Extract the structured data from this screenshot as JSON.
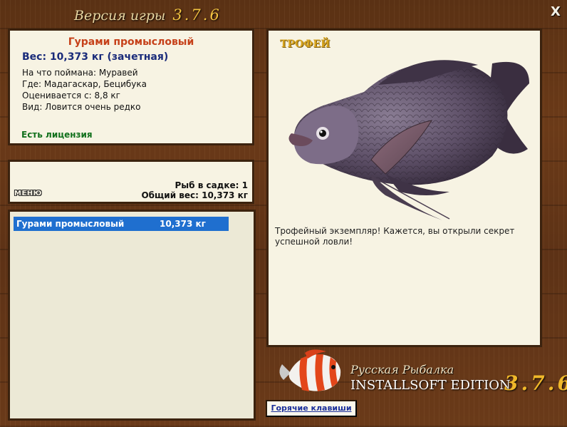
{
  "window": {
    "title_prefix": "Версия игры",
    "version": "3.7.6",
    "close_label": "X"
  },
  "catch_info": {
    "fish_name": "Гурами промысловый",
    "weight_line": "Вес: 10,373 кг (зачетная)",
    "bait": "На что поймана: Муравей",
    "location": "Где: Мадагаскар, Бецибука",
    "rated_from": "Оценивается с: 8,8 кг",
    "rarity": "Вид: Ловится очень редко",
    "license": "Есть лицензия"
  },
  "summary": {
    "menu_label": "МЕНЮ",
    "fish_count": "Рыб в садке: 1",
    "total_weight": "Общий вес: 10,373 кг"
  },
  "catch_list": [
    {
      "name": "Гурами промысловый",
      "weight": "10,373 кг"
    }
  ],
  "trophy": {
    "label": "ТРОФЕЙ",
    "description": "Трофейный экземпляр! Кажется, вы открыли секрет успешной ловли!"
  },
  "brand": {
    "line1": "Русская Рыбалка",
    "line2": "INSTALLSOFT EDITION",
    "version": "3.7.6"
  },
  "hotkeys_label": "Горячие клавиши"
}
